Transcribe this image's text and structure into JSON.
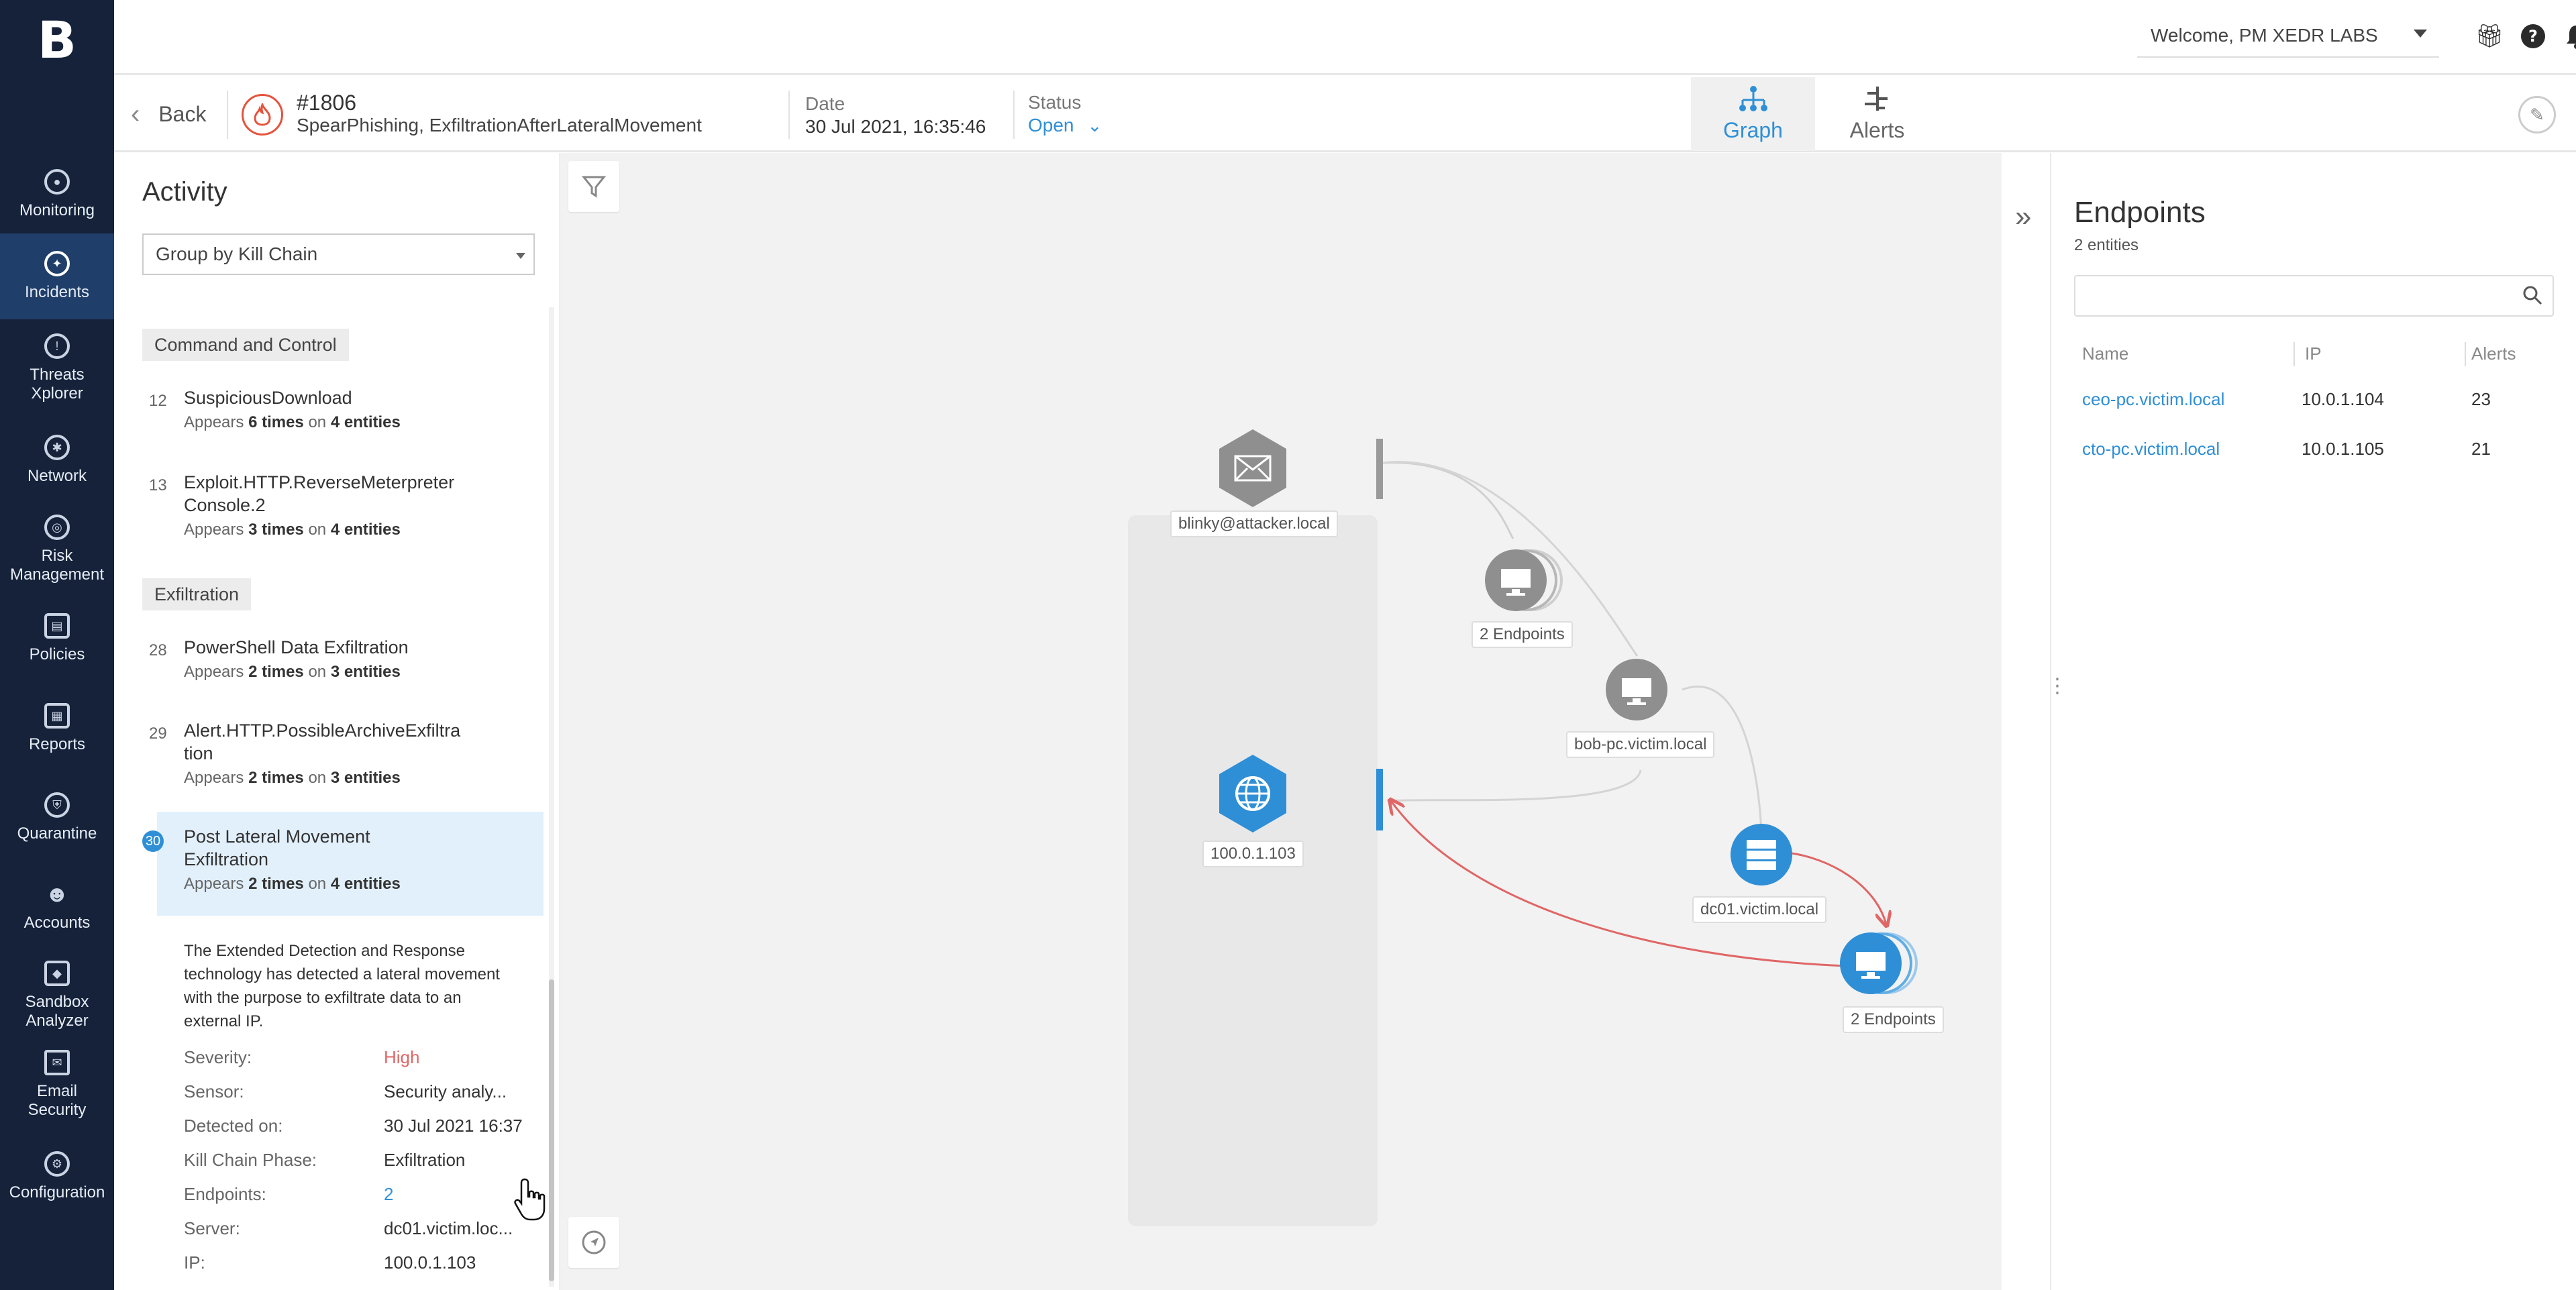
{
  "app": {
    "logo": "B",
    "user_welcome": "Welcome, PM XEDR LABS"
  },
  "nav": [
    {
      "label": "Monitoring",
      "icon": "monitoring-icon",
      "active": false
    },
    {
      "label": "Incidents",
      "icon": "incidents-icon",
      "active": true
    },
    {
      "label": "Threats Xplorer",
      "icon": "threats-icon",
      "active": false
    },
    {
      "label": "Network",
      "icon": "network-icon",
      "active": false
    },
    {
      "label": "Risk Management",
      "icon": "risk-icon",
      "active": false
    },
    {
      "label": "Policies",
      "icon": "policies-icon",
      "active": false
    },
    {
      "label": "Reports",
      "icon": "reports-icon",
      "active": false
    },
    {
      "label": "Quarantine",
      "icon": "quarantine-icon",
      "active": false
    },
    {
      "label": "Accounts",
      "icon": "accounts-icon",
      "active": false
    },
    {
      "label": "Sandbox Analyzer",
      "icon": "sandbox-icon",
      "active": false
    },
    {
      "label": "Email Security",
      "icon": "email-icon",
      "active": false
    },
    {
      "label": "Configuration",
      "icon": "configuration-icon",
      "active": false
    }
  ],
  "header": {
    "back_label": "Back",
    "incident_number": "#1806",
    "incident_name": "SpearPhishing, ExfiltrationAfterLateralMovement",
    "date_label": "Date",
    "date_value": "30 Jul 2021, 16:35:46",
    "status_label": "Status",
    "status_value": "Open",
    "tabs": [
      {
        "label": "Graph",
        "active": true
      },
      {
        "label": "Alerts",
        "active": false
      }
    ]
  },
  "activity": {
    "title": "Activity",
    "group_by": "Group by Kill Chain",
    "categories": {
      "command_control": "Command and Control",
      "exfiltration": "Exfiltration"
    },
    "items": [
      {
        "num": "12",
        "name": "SuspiciousDownload",
        "times": "6 times",
        "entities": "4 entities"
      },
      {
        "num": "13",
        "name": "Exploit.HTTP.ReverseMeterpreter Console.2",
        "times": "3 times",
        "entities": "4 entities"
      },
      {
        "num": "28",
        "name": "PowerShell Data Exfiltration",
        "times": "2 times",
        "entities": "3 entities"
      },
      {
        "num": "29",
        "name": "Alert.HTTP.PossibleArchiveExfiltra tion",
        "times": "2 times",
        "entities": "3 entities"
      },
      {
        "num": "30",
        "name": "Post Lateral Movement Exfiltration",
        "times": "2 times",
        "entities": "4 entities"
      }
    ],
    "appears_word": "Appears",
    "on_word": "on",
    "detail": {
      "description": "The Extended Detection and Response technology has detected a lateral movement with the purpose to exfiltrate data to an external IP.",
      "fields": [
        {
          "label": "Severity:",
          "value": "High"
        },
        {
          "label": "Sensor:",
          "value": "Security analy..."
        },
        {
          "label": "Detected on:",
          "value": "30 Jul 2021 16:37"
        },
        {
          "label": "Kill Chain Phase:",
          "value": "Exfiltration"
        },
        {
          "label": "Endpoints:",
          "value": "2"
        },
        {
          "label": "Server:",
          "value": "dc01.victim.loc..."
        },
        {
          "label": "IP:",
          "value": "100.0.1.103"
        }
      ]
    }
  },
  "graph": {
    "nodes": {
      "email": "blinky@attacker.local",
      "ip": "100.0.1.103",
      "endpoints_gray": "2 Endpoints",
      "bob": "bob-pc.victim.local",
      "dc01": "dc01.victim.local",
      "endpoints_blue": "2 Endpoints"
    },
    "colors": {
      "blue": "#2f8fd6",
      "gray": "#8f8f8f",
      "red_edge": "#e06666"
    }
  },
  "endpoints_panel": {
    "title": "Endpoints",
    "count": "2 entities",
    "search_placeholder": "",
    "columns": [
      "Name",
      "IP",
      "Alerts"
    ],
    "rows": [
      {
        "name": "ceo-pc.victim.local",
        "ip": "10.0.1.104",
        "alerts": "23"
      },
      {
        "name": "cto-pc.victim.local",
        "ip": "10.0.1.105",
        "alerts": "21"
      }
    ]
  }
}
